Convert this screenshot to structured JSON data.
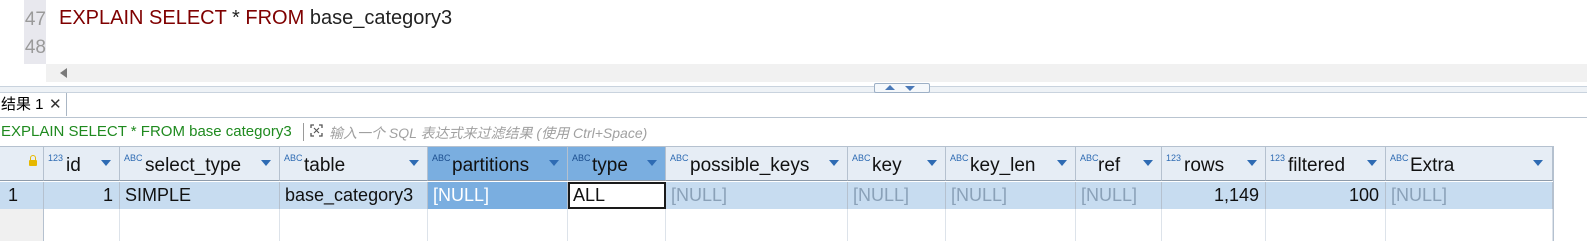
{
  "editor": {
    "line_numbers": [
      "47",
      "48"
    ],
    "sql": {
      "kw1": "EXPLAIN SELECT",
      "star": " * ",
      "kw2": "FROM",
      "table": " base_category3"
    }
  },
  "results_tab": {
    "label": "结果 1",
    "close": "✕"
  },
  "filter_bar": {
    "query_label": "EXPLAIN SELECT * FROM base  category3",
    "placeholder": "输入一个 SQL 表达式来过滤结果 (使用 Ctrl+Space)"
  },
  "grid": {
    "columns": [
      {
        "name": "id",
        "type_badge": "123"
      },
      {
        "name": "select_type",
        "type_badge": "ABC"
      },
      {
        "name": "table",
        "type_badge": "ABC"
      },
      {
        "name": "partitions",
        "type_badge": "ABC"
      },
      {
        "name": "type",
        "type_badge": "ABC"
      },
      {
        "name": "possible_keys",
        "type_badge": "ABC"
      },
      {
        "name": "key",
        "type_badge": "ABC"
      },
      {
        "name": "key_len",
        "type_badge": "ABC"
      },
      {
        "name": "ref",
        "type_badge": "ABC"
      },
      {
        "name": "rows",
        "type_badge": "123"
      },
      {
        "name": "filtered",
        "type_badge": "123"
      },
      {
        "name": "Extra",
        "type_badge": "ABC"
      }
    ],
    "rows": [
      {
        "row_number": "1",
        "cells": [
          "1",
          "SIMPLE",
          "base_category3",
          "[NULL]",
          "ALL",
          "[NULL]",
          "[NULL]",
          "[NULL]",
          "[NULL]",
          "1,149",
          "100",
          "[NULL]"
        ]
      }
    ]
  },
  "colors": {
    "keyword": "#7f0000",
    "header_bg": "#e6edf5",
    "selected_column": "#7aaee0",
    "row_bg": "#c7dcf0",
    "null_text": "#8aa1b8",
    "query_label": "#1f8a1f"
  },
  "icons": [
    "lock-icon",
    "sort-arrow-icon",
    "filter-expand-icon",
    "close-icon",
    "scroll-left-icon",
    "splitter-up-icon",
    "splitter-down-icon"
  ]
}
